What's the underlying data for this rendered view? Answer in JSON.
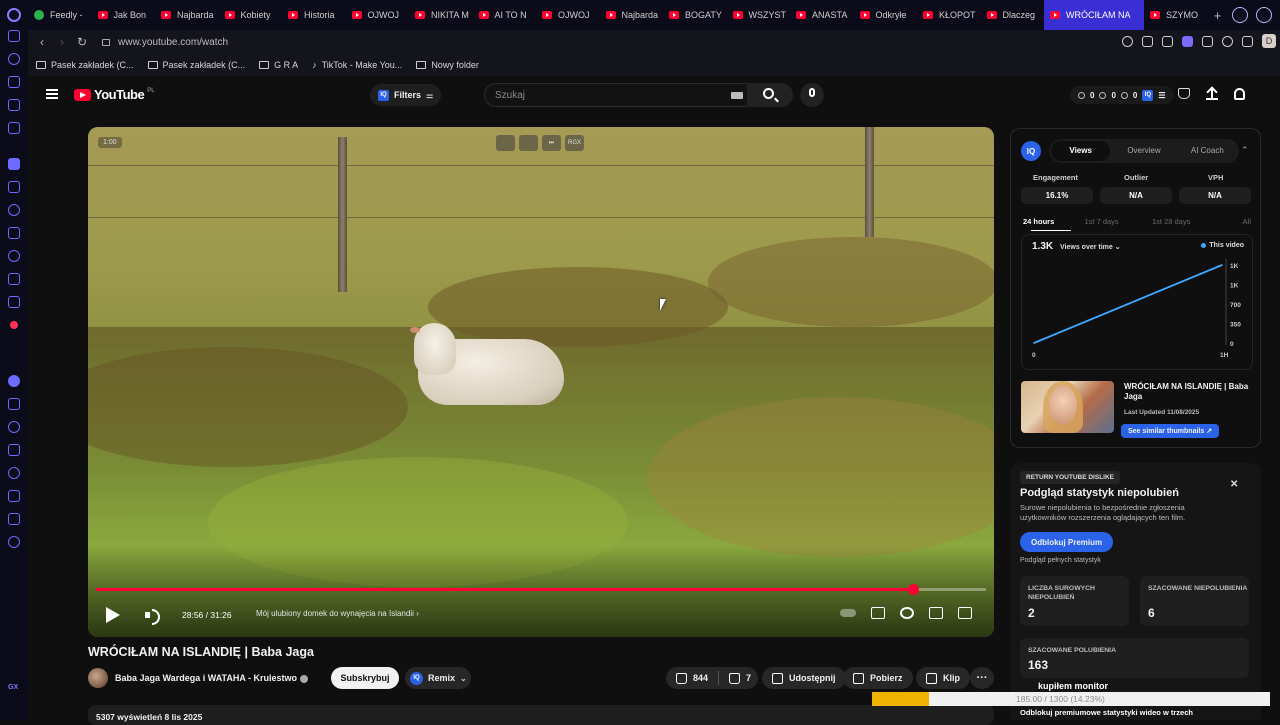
{
  "browser": {
    "tabs": [
      {
        "label": "Feedly -",
        "icon": "feedly-icon",
        "active": false
      },
      {
        "label": "Jak Bon",
        "icon": "youtube-icon",
        "active": false
      },
      {
        "label": "Najbarda",
        "icon": "youtube-icon",
        "active": false
      },
      {
        "label": "Kobiety",
        "icon": "youtube-icon",
        "active": false
      },
      {
        "label": "Historia",
        "icon": "youtube-icon",
        "active": false
      },
      {
        "label": "OJWOJ",
        "icon": "youtube-icon",
        "active": false
      },
      {
        "label": "NIKITA M",
        "icon": "youtube-icon",
        "active": false
      },
      {
        "label": "AI TO N",
        "icon": "youtube-icon",
        "active": false
      },
      {
        "label": "OJWOJ",
        "icon": "youtube-icon",
        "active": false
      },
      {
        "label": "Najbarda",
        "icon": "youtube-icon",
        "active": false
      },
      {
        "label": "BOGATY",
        "icon": "youtube-icon",
        "active": false
      },
      {
        "label": "WSZYST",
        "icon": "youtube-icon",
        "active": false
      },
      {
        "label": "ANASTA",
        "icon": "youtube-icon",
        "active": false
      },
      {
        "label": "Odkryłe",
        "icon": "youtube-icon",
        "active": false
      },
      {
        "label": "KŁOPOT",
        "icon": "youtube-icon",
        "active": false
      },
      {
        "label": "Dlaczeg",
        "icon": "youtube-icon",
        "active": false
      },
      {
        "label": "WRÓCIŁAM NA",
        "icon": "youtube-icon",
        "active": true
      },
      {
        "label": "SZYMO",
        "icon": "youtube-icon",
        "active": false
      }
    ],
    "new_tab": "+",
    "url": "www.youtube.com/watch",
    "profile_initial": "D",
    "bookmarks": [
      {
        "label": "Pasek zakładek (C...",
        "icon": "folder-icon"
      },
      {
        "label": "Pasek zakładek (C...",
        "icon": "folder-icon"
      },
      {
        "label": "G R A",
        "icon": "folder-icon"
      },
      {
        "label": "TikTok - Make You...",
        "icon": "tiktok-icon"
      },
      {
        "label": "Nowy folder",
        "icon": "folder-icon"
      }
    ],
    "sidebar_footer": "GX",
    "accent": "#3a2fd4"
  },
  "header": {
    "logo_text": "YouTube",
    "logo_country": "PL",
    "filters_label": "Filters",
    "iq_badge": "IQ",
    "search_placeholder": "Szukaj",
    "stats": [
      "0",
      "0",
      "0"
    ]
  },
  "video": {
    "badge": "1:00",
    "top_buttons": [
      "",
      "",
      "",
      "RGX"
    ],
    "progress": 0.9175,
    "time": "28:56 / 31:26",
    "chapter": "Mój ulubiony domek do wynajęcia na Islandii  ›"
  },
  "meta": {
    "title": "WRÓCIŁAM NA ISLANDIĘ | Baba Jaga",
    "channel": "Baba Jaga Wardega i WATAHA - Krulestwo",
    "subscribe": "Subskrybuj",
    "remix": "Remix",
    "likes": "844",
    "dislikes": "7",
    "share": "Udostępnij",
    "download": "Pobierz",
    "clip": "Klip",
    "more": "···",
    "views_line": "5307 wyświetleń  8 lis 2025"
  },
  "iq": {
    "logo": "IQ",
    "tabs": [
      "Views",
      "Overview",
      "AI Coach"
    ],
    "metrics": [
      {
        "label": "Engagement",
        "value": "16.1%"
      },
      {
        "label": "Outlier",
        "value": "N/A"
      },
      {
        "label": "VPH",
        "value": "N/A"
      }
    ],
    "ranges": [
      "24 hours",
      "1st 7 days",
      "1st 28 days",
      "All"
    ],
    "graph_value": "1.3K",
    "graph_metric": "Views over time ⌄",
    "graph_legend": "This video",
    "y_ticks": [
      "1K",
      "1K",
      "700",
      "350",
      "0"
    ],
    "x_ticks": [
      "0",
      "1H"
    ],
    "video_title": "WRÓCIŁAM NA ISLANDIĘ | Baba Jaga",
    "last_updated": "Last Updated 11/08/2025",
    "similar_btn": "See similar thumbnails ↗"
  },
  "chart_data": {
    "type": "line",
    "title": "Views over time",
    "x": [
      0,
      1
    ],
    "xlabel": "",
    "ylabel": "",
    "ylim": [
      0,
      1300
    ],
    "series": [
      {
        "name": "This video",
        "values": [
          0,
          1300
        ]
      }
    ],
    "x_tick_labels": [
      "0",
      "1H"
    ],
    "y_tick_labels": [
      "0",
      "350",
      "700",
      "1K",
      "1K"
    ]
  },
  "ryd": {
    "badge": "RETURN YOUTUBE DISLIKE",
    "title": "Podgląd statystyk niepolubień",
    "desc": "Surowe niepolubienia to bezpośrednie zgłoszenia użytkowników rozszerzenia oglądających ten film.",
    "premium": "Odblokuj Premium",
    "sub": "Podgląd pełnych statystyk",
    "raw_label": "LICZBA SUROWYCH NIEPOLUBIEŃ",
    "raw_value": "2",
    "est_dis_label": "SZACOWANE NIEPOLUBIENIA",
    "est_dis_value": "6",
    "est_like_label": "SZACOWANE POLUBIENIA",
    "est_like_value": "163",
    "footer": "Odblokuj premiumowe statystyki wideo w trzech"
  },
  "overlay": {
    "label": "kupiłem monitor",
    "progress": 0.1423,
    "text": "185.00 / 1300 (14.23%)"
  }
}
